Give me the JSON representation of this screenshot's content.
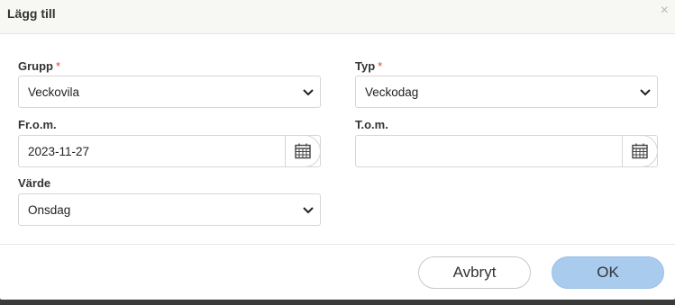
{
  "dialog": {
    "title": "Lägg till",
    "close_symbol": "×"
  },
  "form": {
    "grupp": {
      "label": "Grupp",
      "required_mark": "*",
      "value": "Veckovila"
    },
    "typ": {
      "label": "Typ",
      "required_mark": "*",
      "value": "Veckodag"
    },
    "from": {
      "label": "Fr.o.m.",
      "value": "2023-11-27"
    },
    "tom": {
      "label": "T.o.m.",
      "value": ""
    },
    "varde": {
      "label": "Värde",
      "value": "Onsdag"
    }
  },
  "footer": {
    "cancel_label": "Avbryt",
    "ok_label": "OK"
  },
  "icons": {
    "dropdown": "chevron-down-icon",
    "date": "calendar-icon",
    "close": "close-icon"
  },
  "colors": {
    "required": "#e0452b",
    "ok_button": "#a9cbee",
    "header_bg": "#f7f7f4"
  }
}
